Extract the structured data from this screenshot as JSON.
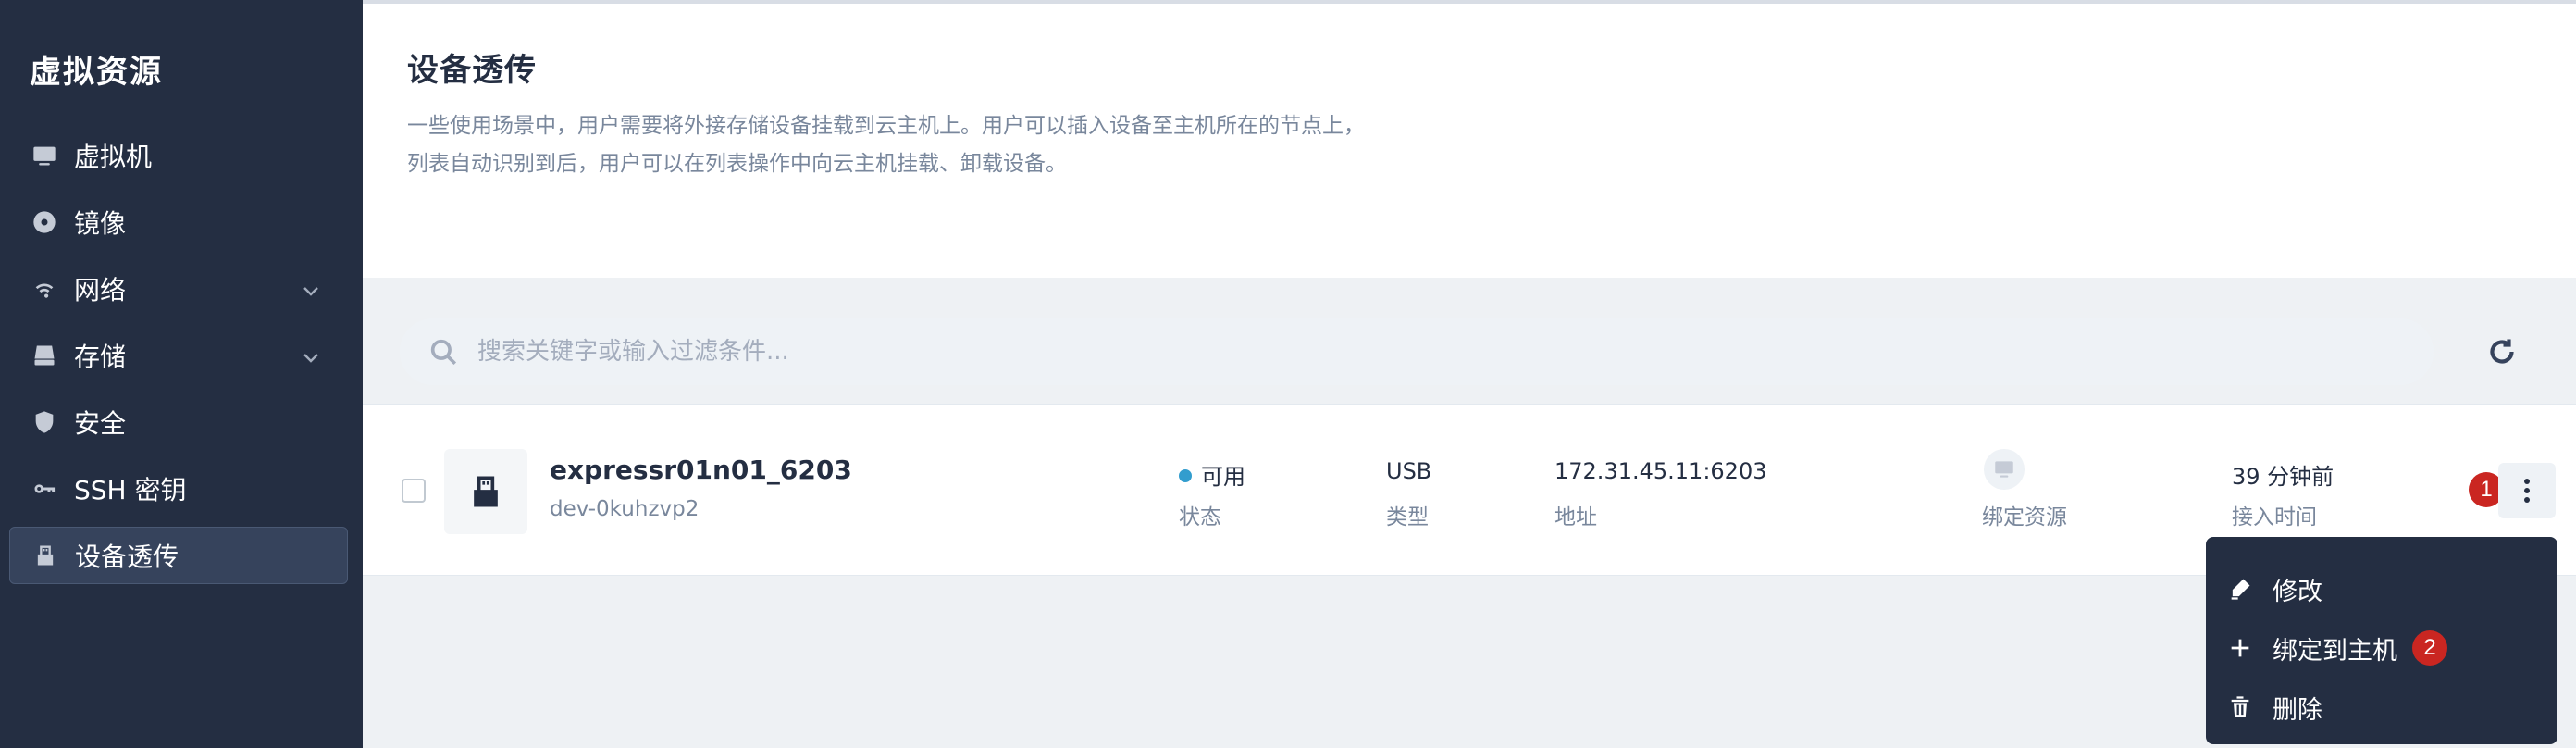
{
  "sidebar": {
    "title": "虚拟资源",
    "items": [
      {
        "label": "虚拟机",
        "icon": "monitor-icon"
      },
      {
        "label": "镜像",
        "icon": "disc-icon"
      },
      {
        "label": "网络",
        "icon": "wifi-icon",
        "expandable": true
      },
      {
        "label": "存储",
        "icon": "hard-drive-icon",
        "expandable": true
      },
      {
        "label": "安全",
        "icon": "shield-icon"
      },
      {
        "label": "SSH 密钥",
        "icon": "key-icon"
      },
      {
        "label": "设备透传",
        "icon": "usb-icon",
        "active": true
      }
    ]
  },
  "header": {
    "title": "设备透传",
    "description_line1": "一些使用场景中，用户需要将外接存储设备挂载到云主机上。用户可以插入设备至主机所在的节点上，",
    "description_line2": "列表自动识别到后，用户可以在列表操作中向云主机挂载、卸载设备。"
  },
  "search": {
    "placeholder": "搜索关键字或输入过滤条件...",
    "value": ""
  },
  "device": {
    "name": "expressr01n01_6203",
    "id": "dev-0kuhzvp2",
    "status_value": "可用",
    "status_label": "状态",
    "status_color": "#329dce",
    "type_value": "USB",
    "type_label": "类型",
    "address_value": "172.31.45.11:6203",
    "address_label": "地址",
    "bind_label": "绑定资源",
    "time_value": "39 分钟前",
    "time_label": "接入时间"
  },
  "badges": {
    "more": "1",
    "bind_host": "2"
  },
  "menu": {
    "edit": "修改",
    "bind_host": "绑定到主机",
    "delete": "删除"
  },
  "colors": {
    "sidebar_bg": "#242e42",
    "badge_red": "#ca2621",
    "accent_blue": "#329dce"
  }
}
